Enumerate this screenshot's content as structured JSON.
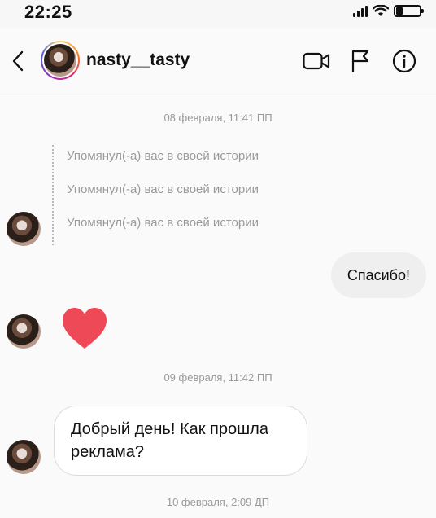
{
  "status_bar": {
    "time": "22:25",
    "battery_level": 0.3
  },
  "header": {
    "username": "nasty__tasty",
    "icons": [
      "back-chevron-icon",
      "video-camera-icon",
      "flag-icon",
      "info-icon"
    ]
  },
  "messages": {
    "timestamp_1": "08 февраля, 11:41 ПП",
    "mentions": [
      "Упомянул(-а) вас в своей истории",
      "Упомянул(-а) вас в своей истории",
      "Упомянул(-а) вас в своей истории"
    ],
    "outgoing_text": "Спасибо!",
    "heart_reaction_icon": "heart-icon",
    "timestamp_2": "09 февраля, 11:42 ПП",
    "incoming_text": "Добрый день! Как прошла реклама?",
    "timestamp_3": "10 февраля, 2:09 ДП"
  },
  "colors": {
    "heart": "#ed4956",
    "bubble_out_bg": "#efefef",
    "timestamp": "#9a9a9a"
  }
}
